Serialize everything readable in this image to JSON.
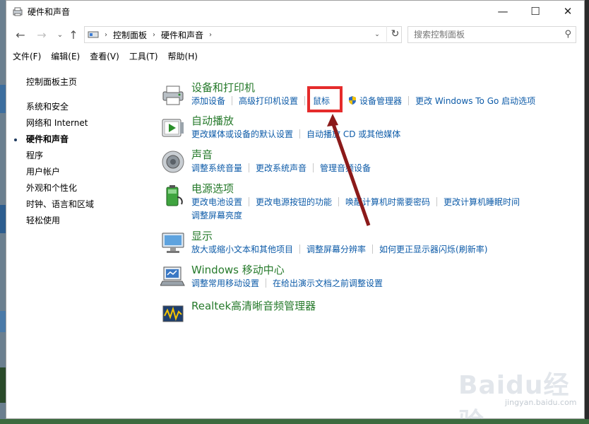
{
  "window": {
    "title": "硬件和声音"
  },
  "window_controls": {
    "minimize": "—",
    "maximize": "☐",
    "close": "✕"
  },
  "address": {
    "crumbs": [
      "控制面板",
      "硬件和声音"
    ],
    "search_placeholder": "搜索控制面板"
  },
  "menu": [
    "文件(F)",
    "编辑(E)",
    "查看(V)",
    "工具(T)",
    "帮助(H)"
  ],
  "sidebar": {
    "home": "控制面板主页",
    "items": [
      "系统和安全",
      "网络和 Internet",
      "硬件和声音",
      "程序",
      "用户帐户",
      "外观和个性化",
      "时钟、语言和区域",
      "轻松使用"
    ],
    "active_index": 2
  },
  "categories": [
    {
      "title": "设备和打印机",
      "icon": "printer-icon",
      "links": [
        "添加设备",
        "高级打印机设置",
        "鼠标",
        "设备管理器",
        "更改 Windows To Go 启动选项"
      ]
    },
    {
      "title": "自动播放",
      "icon": "autoplay-icon",
      "links": [
        "更改媒体或设备的默认设置",
        "自动播放 CD 或其他媒体"
      ]
    },
    {
      "title": "声音",
      "icon": "speaker-icon",
      "links": [
        "调整系统音量",
        "更改系统声音",
        "管理音频设备"
      ]
    },
    {
      "title": "电源选项",
      "icon": "battery-icon",
      "links": [
        "更改电池设置",
        "更改电源按钮的功能",
        "唤醒计算机时需要密码",
        "更改计算机睡眠时间",
        "调整屏幕亮度"
      ]
    },
    {
      "title": "显示",
      "icon": "monitor-icon",
      "links": [
        "放大或缩小文本和其他项目",
        "调整屏幕分辨率",
        "如何更正显示器闪烁(刷新率)"
      ]
    },
    {
      "title": "Windows 移动中心",
      "icon": "mobility-center-icon",
      "links": [
        "调整常用移动设置",
        "在给出演示文档之前调整设置"
      ]
    },
    {
      "title": "Realtek高清晰音频管理器",
      "icon": "realtek-audio-icon",
      "links": []
    }
  ],
  "watermark": {
    "text": "Baidu经验",
    "sub": "jingyan.baidu.com"
  },
  "colors": {
    "category_title": "#267a2b",
    "link": "#0d5ba8",
    "highlight": "#e52b2b",
    "arrow": "#8b1a1a"
  }
}
